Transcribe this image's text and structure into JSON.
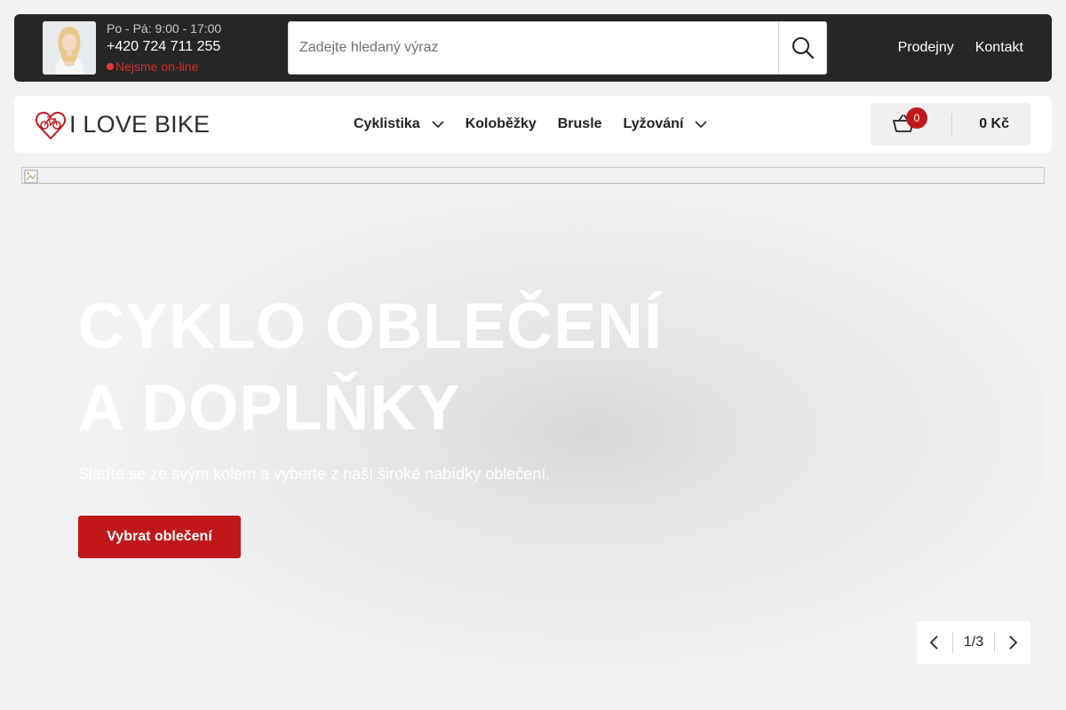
{
  "topbar": {
    "hours": "Po - Pá: 9:00 - 17:00",
    "phone": "+420 724 711 255",
    "status": "Nejsme on-line",
    "links": [
      "Prodejny",
      "Kontakt"
    ]
  },
  "search": {
    "placeholder": "Zadejte hledaný výraz"
  },
  "header": {
    "logo_text": "I LOVE BIKE",
    "nav": [
      {
        "label": "Cyklistika",
        "has_dropdown": true
      },
      {
        "label": "Koloběžky",
        "has_dropdown": false
      },
      {
        "label": "Brusle",
        "has_dropdown": false
      },
      {
        "label": "Lyžování",
        "has_dropdown": true
      }
    ],
    "cart": {
      "count": "0",
      "total": "0 Kč"
    }
  },
  "hero": {
    "title_line1": "CYKLO OBLEČENÍ",
    "title_line2": "A DOPLŇKY",
    "subtitle": "Slaďte se ze svým kolem a vyberte z naší široké nabídky oblečení.",
    "cta": "Vybrat oblečení",
    "pager": "1/3"
  },
  "colors": {
    "accent": "#c0171b",
    "topbar_bg": "#262626",
    "page_bg": "#f2f2f2",
    "offline": "#d32f2f"
  },
  "icons": [
    "search-icon",
    "heart-bike-logo-icon",
    "chevron-down-icon",
    "basket-icon",
    "chevron-left-icon",
    "chevron-right-icon",
    "broken-image-icon"
  ]
}
